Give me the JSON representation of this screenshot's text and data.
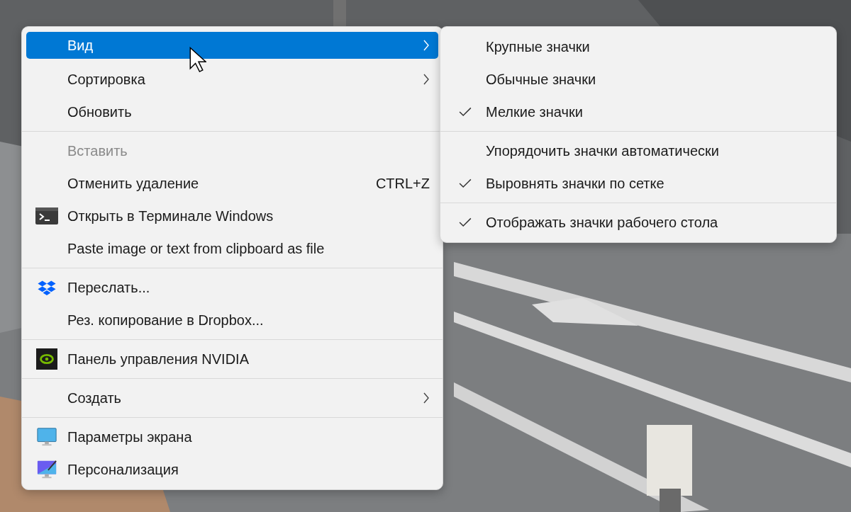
{
  "context_menu": {
    "items": [
      {
        "kind": "item",
        "label": "Вид",
        "submenu": true,
        "selected": true,
        "disabled": false
      },
      {
        "kind": "item",
        "label": "Сортировка",
        "submenu": true,
        "selected": false,
        "disabled": false
      },
      {
        "kind": "item",
        "label": "Обновить",
        "selected": false,
        "disabled": false
      },
      {
        "kind": "separator"
      },
      {
        "kind": "item",
        "label": "Вставить",
        "selected": false,
        "disabled": true
      },
      {
        "kind": "item",
        "label": "Отменить удаление",
        "shortcut": "CTRL+Z",
        "selected": false,
        "disabled": false
      },
      {
        "kind": "terminal",
        "label": "Открыть в Терминале Windows",
        "selected": false,
        "disabled": false
      },
      {
        "kind": "item",
        "label": "Paste image or text from clipboard as file",
        "selected": false,
        "disabled": false
      },
      {
        "kind": "separator"
      },
      {
        "kind": "dropbox",
        "label": "Переслать...",
        "selected": false,
        "disabled": false
      },
      {
        "kind": "item",
        "label": "Рез. копирование в Dropbox...",
        "selected": false,
        "disabled": false
      },
      {
        "kind": "separator"
      },
      {
        "kind": "nvidia",
        "label": "Панель управления NVIDIA",
        "selected": false,
        "disabled": false
      },
      {
        "kind": "separator"
      },
      {
        "kind": "item",
        "label": "Создать",
        "submenu": true,
        "selected": false,
        "disabled": false
      },
      {
        "kind": "separator"
      },
      {
        "kind": "display",
        "label": "Параметры экрана",
        "selected": false,
        "disabled": false
      },
      {
        "kind": "personalize",
        "label": "Персонализация",
        "selected": false,
        "disabled": false
      }
    ]
  },
  "submenu": {
    "items": [
      {
        "kind": "item",
        "label": "Крупные значки",
        "checked": false
      },
      {
        "kind": "item",
        "label": "Обычные значки",
        "checked": false
      },
      {
        "kind": "item",
        "label": "Мелкие значки",
        "checked": true
      },
      {
        "kind": "separator"
      },
      {
        "kind": "item",
        "label": "Упорядочить значки автоматически",
        "checked": false
      },
      {
        "kind": "item",
        "label": "Выровнять значки по сетке",
        "checked": true
      },
      {
        "kind": "separator"
      },
      {
        "kind": "item",
        "label": "Отображать значки рабочего стола",
        "checked": true
      }
    ]
  }
}
